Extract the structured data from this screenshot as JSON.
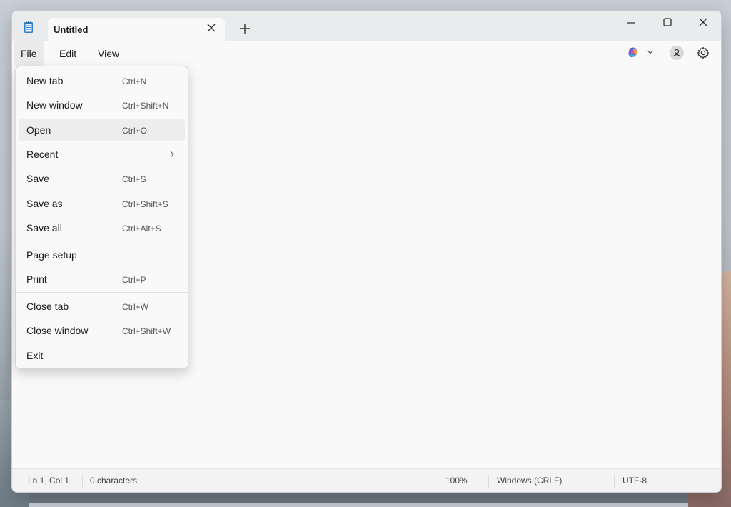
{
  "window": {
    "tab_title": "Untitled"
  },
  "menubar": {
    "items": [
      {
        "label": "File"
      },
      {
        "label": "Edit"
      },
      {
        "label": "View"
      }
    ]
  },
  "file_menu": {
    "groups": [
      [
        {
          "label": "New tab",
          "shortcut": "Ctrl+N"
        },
        {
          "label": "New window",
          "shortcut": "Ctrl+Shift+N"
        },
        {
          "label": "Open",
          "shortcut": "Ctrl+O"
        },
        {
          "label": "Recent",
          "shortcut": ""
        },
        {
          "label": "Save",
          "shortcut": "Ctrl+S"
        },
        {
          "label": "Save as",
          "shortcut": "Ctrl+Shift+S"
        },
        {
          "label": "Save all",
          "shortcut": "Ctrl+Alt+S"
        }
      ],
      [
        {
          "label": "Page setup",
          "shortcut": ""
        },
        {
          "label": "Print",
          "shortcut": "Ctrl+P"
        }
      ],
      [
        {
          "label": "Close tab",
          "shortcut": "Ctrl+W"
        },
        {
          "label": "Close window",
          "shortcut": "Ctrl+Shift+W"
        },
        {
          "label": "Exit",
          "shortcut": ""
        }
      ]
    ]
  },
  "statusbar": {
    "position": "Ln 1, Col 1",
    "characters": "0 characters",
    "zoom": "100%",
    "line_ending": "Windows (CRLF)",
    "encoding": "UTF-8"
  },
  "icons": {
    "app": "notepad-icon",
    "tab_close": "close-icon",
    "new_tab": "plus-icon",
    "minimize": "minimize-icon",
    "maximize": "maximize-icon",
    "close": "close-icon",
    "copilot": "copilot-icon",
    "account": "account-icon",
    "settings": "gear-icon"
  },
  "colors": {
    "hover": "#ededed",
    "titlebar": "#e9ebed",
    "surface": "#f9f9f9"
  }
}
